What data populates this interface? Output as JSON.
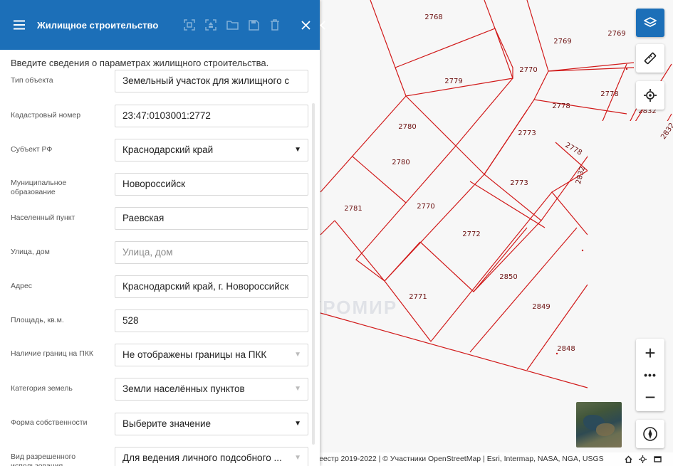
{
  "header": {
    "title": "Жилищное строительство",
    "icons": [
      "menu-icon",
      "focus-icon",
      "target-icon",
      "folder-icon",
      "save-icon",
      "delete-icon",
      "close-icon",
      "collapse-icon"
    ]
  },
  "form": {
    "intro": "Введите сведения о параметрах жилищного строительства.",
    "fields": [
      {
        "label": "Тип объекта",
        "value": "Земельный участок для жилищного с",
        "kind": "text"
      },
      {
        "label": "Кадастровый номер",
        "value": "23:47:0103001:2772",
        "kind": "text"
      },
      {
        "label": "Субъект РФ",
        "value": "Краснодарский край",
        "kind": "select"
      },
      {
        "label": "Муниципальное образование",
        "value": "Новороссийск",
        "kind": "text"
      },
      {
        "label": "Населенный пункт",
        "value": "Раевская",
        "kind": "text"
      },
      {
        "label": "Улица, дом",
        "value": "Улица, дом",
        "kind": "placeholder"
      },
      {
        "label": "Адрес",
        "value": "Краснодарский край, г. Новороссийск",
        "kind": "text"
      },
      {
        "label": "Площадь, кв.м.",
        "value": "528",
        "kind": "text"
      },
      {
        "label": "Наличие границ на ПКК",
        "value": "Не отображены границы на ПКК",
        "kind": "select-disabled"
      },
      {
        "label": "Категория земель",
        "value": "Земли населённых пунктов",
        "kind": "select-disabled"
      },
      {
        "label": "Форма собственности",
        "value": "Выберите значение",
        "kind": "select"
      },
      {
        "label": "Вид разрешенного использования",
        "value": "Для ведения личного подсобного ...",
        "kind": "select-disabled"
      }
    ]
  },
  "map": {
    "parcel_labels": [
      "2768",
      "2769",
      "2769",
      "2770",
      "2779",
      "2778",
      "2778",
      "2832",
      "2832",
      "2780",
      "2780",
      "2773",
      "2778",
      "2773",
      "2832",
      "2781",
      "2770",
      "2772",
      "2850",
      "2771",
      "2849",
      "2848"
    ],
    "controls": {
      "layers": "layers-icon",
      "ruler": "ruler-icon",
      "locate": "locate-icon",
      "zoom_in": "+",
      "more": "•••",
      "zoom_out": "−",
      "compass": "compass-icon"
    },
    "attribution": "еестр 2019-2022 | © Участники OpenStreetMap | Esri, Intermap, NASA, NGA, USGS",
    "watermark": "МАКРОМИР",
    "line_color": "#d11a1a",
    "accent": "#1c6fb8"
  }
}
